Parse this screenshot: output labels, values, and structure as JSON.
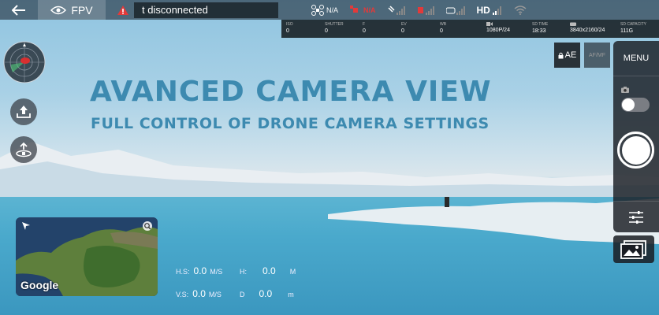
{
  "topbar": {
    "fpv_label": "FPV",
    "status_text": "t disconnected",
    "drone_status": "N/A",
    "gps_label": "N/A",
    "hd_label": "HD"
  },
  "camstrip": [
    {
      "label": "ISO",
      "value": "0"
    },
    {
      "label": "SHUTTER",
      "value": "0"
    },
    {
      "label": "F",
      "value": "0"
    },
    {
      "label": "EV",
      "value": "0"
    },
    {
      "label": "WB",
      "value": "0"
    },
    {
      "label": "",
      "value": "1080P/24"
    },
    {
      "label": "SD TIME",
      "value": "18:33"
    },
    {
      "label": "",
      "value": "3840x2160/24"
    },
    {
      "label": "SD CAPACITY",
      "value": "111G"
    }
  ],
  "headline": "AVANCED CAMERA VIEW",
  "subline": "FULL CONTROL OF DRONE CAMERA SETTINGS",
  "map": {
    "brand": "Google"
  },
  "telemetry": {
    "hs_label": "H.S:",
    "hs_value": "0.0",
    "hs_unit": "M/S",
    "h_label": "H:",
    "h_value": "0.0",
    "h_unit": "M",
    "vs_label": "V.S:",
    "vs_value": "0.0",
    "vs_unit": "M/S",
    "d_label": "D",
    "d_value": "0.0",
    "d_unit": "m"
  },
  "controls": {
    "ae_label": "AE",
    "afmf_label": "AF/MF",
    "menu_label": "MENU"
  },
  "colors": {
    "headline": "#3d8ab0",
    "warning": "#e23a3a",
    "panel": "#191c22"
  }
}
